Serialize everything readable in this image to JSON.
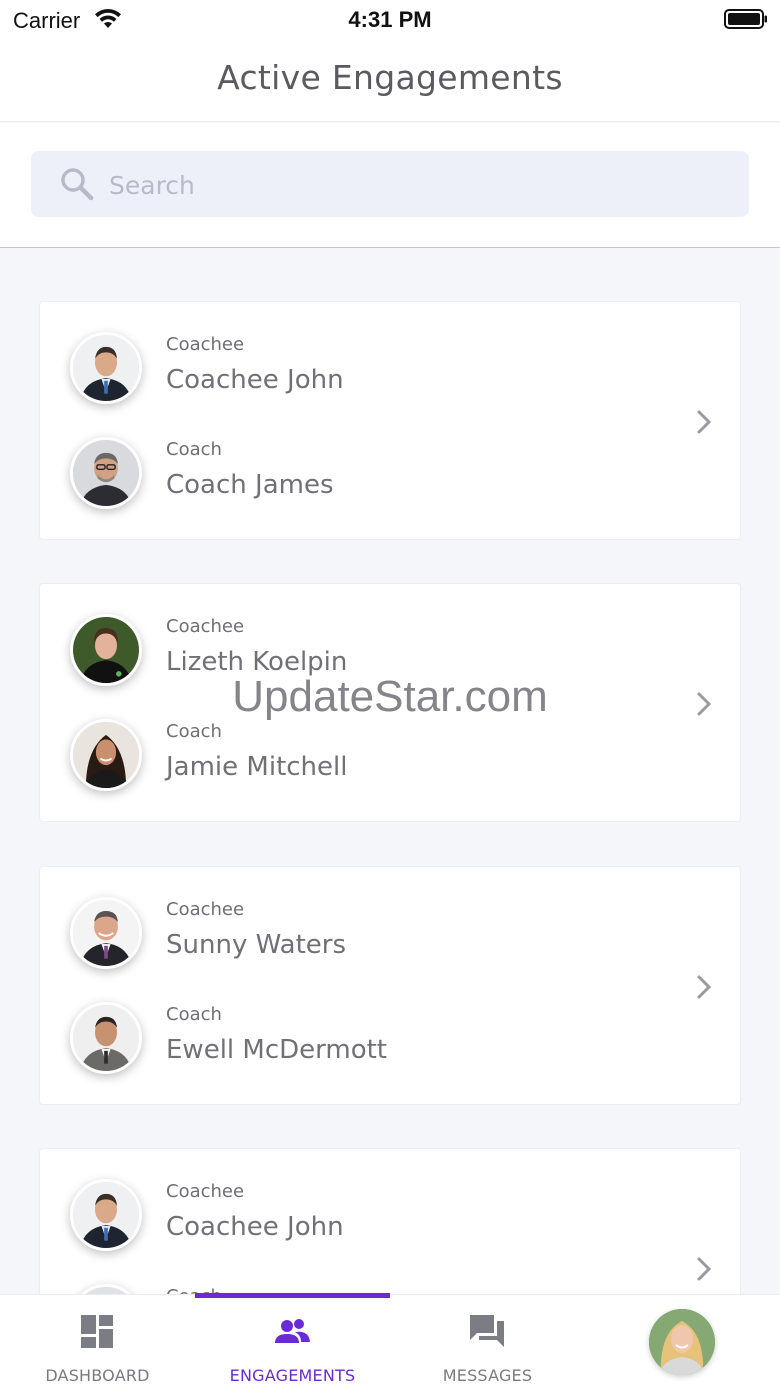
{
  "status_bar": {
    "carrier": "Carrier",
    "time": "4:31 PM",
    "icons": [
      "wifi-icon",
      "battery-icon"
    ]
  },
  "header": {
    "title": "Active Engagements"
  },
  "search": {
    "placeholder": "Search",
    "icon": "search-icon"
  },
  "engagements": [
    {
      "coachee_role": "Coachee",
      "coachee_name": "Coachee John",
      "coach_role": "Coach",
      "coach_name": "Coach James"
    },
    {
      "coachee_role": "Coachee",
      "coachee_name": "Lizeth Koelpin",
      "coach_role": "Coach",
      "coach_name": "Jamie Mitchell"
    },
    {
      "coachee_role": "Coachee",
      "coachee_name": "Sunny Waters",
      "coach_role": "Coach",
      "coach_name": "Ewell McDermott"
    },
    {
      "coachee_role": "Coachee",
      "coachee_name": "Coachee John",
      "coach_role": "Coach",
      "coach_name": ""
    }
  ],
  "watermark": "UpdateStar.com",
  "tabbar": {
    "active_color": "#6a2ad6",
    "tabs": [
      {
        "label": "DASHBOARD",
        "icon": "dashboard-icon",
        "active": false
      },
      {
        "label": "ENGAGEMENTS",
        "icon": "people-icon",
        "active": true
      },
      {
        "label": "MESSAGES",
        "icon": "chat-icon",
        "active": false
      },
      {
        "label": "",
        "icon": "profile-avatar",
        "active": false
      }
    ]
  }
}
